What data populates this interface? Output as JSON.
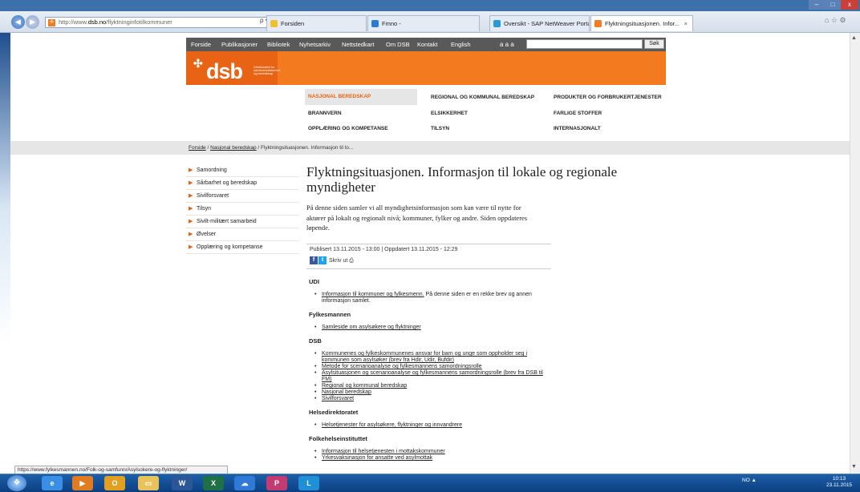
{
  "browser": {
    "window_controls": {
      "minimize": "–",
      "maximize": "□",
      "close": "x"
    },
    "back_icon": "back-arrow-icon",
    "forward_icon": "forward-arrow-icon",
    "address": {
      "prefix": "http://www.",
      "host": "dsb.no",
      "path": "/flyktninginfotilkommuner"
    },
    "address_tools": "ρ ▾ C",
    "tabs": [
      {
        "label": "Forsiden",
        "icon_color": "#f0c030"
      },
      {
        "label": "Fmno -",
        "icon_color": "#2a7bd6"
      },
      {
        "label": "Oversikt - SAP NetWeaver Portal",
        "icon_color": "#2a9ad6"
      },
      {
        "label": "Flyktningsituasjonen. Infor...",
        "icon_color": "#f47b20"
      }
    ],
    "tab_close": "×",
    "right_tools": "⌂ ☆ ⚙"
  },
  "site": {
    "topnav": [
      "Forside",
      "Publikasjoner",
      "Bibliotek",
      "Nyhetsarkiv",
      "Nettstedkart",
      "Om DSB",
      "Kontakt",
      "English"
    ],
    "font_size_links": "a a a",
    "search_button": "Søk",
    "logo_text": "dsb",
    "logo_mark": "✣",
    "logo_subtitle": "Direktoratet for samfunnssikkerhet og beredskap",
    "megamenu": [
      "NASJONAL BEREDSKAP",
      "REGIONAL OG KOMMUNAL BEREDSKAP",
      "PRODUKTER OG FORBRUKERTJENESTER",
      "BRANNVERN",
      "ELSIKKERHET",
      "FARLIGE STOFFER",
      "OPPLÆRING OG KOMPETANSE",
      "TILSYN",
      "INTERNASJONALT"
    ],
    "breadcrumb": {
      "home": "Forside",
      "sep": "/",
      "section": "Nasjonal beredskap",
      "current": "Flyktningsituasjonen. Informasjon til lo..."
    },
    "leftnav": [
      "Samordning",
      "Sårbarhet og beredskap",
      "Sivilforsvaret",
      "Tilsyn",
      "Sivilt-militært samarbeid",
      "Øvelser",
      "Opplæring og kompetanse"
    ],
    "accent_color": "#f47a20"
  },
  "article": {
    "title": "Flyktningsituasjonen. Informasjon til lokale og regionale myndigheter",
    "lead": "På denne siden samler vi all myndighetsinformasjon som kan være til nytte for aktører på lokalt og regionalt nivå; kommuner, fylker og andre. Siden oppdateres løpende.",
    "published": "Publisert 13.11.2015 - 13:00 | Oppdatert 13.11.2015 - 12:29",
    "print_label": "Skriv ut",
    "sections": [
      {
        "heading": "UDI",
        "items": [
          {
            "link": "Informasjon til kommuner og fylkesmenn.",
            "text": " På denne siden er en rekke brev og annen informasjon samlet."
          }
        ]
      },
      {
        "heading": "Fylkesmannen",
        "items": [
          {
            "link": "Samleside om asylsøkere og flyktninger",
            "text": ""
          }
        ]
      },
      {
        "heading": "DSB",
        "items": [
          {
            "link": "Kommunenes og fylkeskommunenes ansvar for barn og unge som oppholder seg i kommunen som asylsøker (brev fra Hdir, Udir, Bufdir)",
            "text": ""
          },
          {
            "link": "Metode for scenarioanalyse og fylkesmannens samordningsrolle",
            "text": ""
          },
          {
            "link": "Asylsituasjonen og scenarioanalyse og fylkesmannens samordningsrolle (brev fra DSB til FM)",
            "text": ""
          },
          {
            "link": "Regional og kommunal beredskap",
            "text": ""
          },
          {
            "link": "Nasjonal beredskap",
            "text": ""
          },
          {
            "link": "Sivilforsvaret",
            "text": ""
          }
        ]
      },
      {
        "heading": "Helsedirektoratet",
        "items": [
          {
            "link": "Helsetjenester for asylsøkere, flyktninger og innvandrere",
            "text": ""
          }
        ]
      },
      {
        "heading": "Folkehelseinstituttet",
        "items": [
          {
            "link": "Informasjon til helsetjenesten i mottakskommuner",
            "text": ""
          },
          {
            "link": "Yrkesvaksinasjon for ansatte ved asylmottak",
            "text": ""
          }
        ]
      }
    ]
  },
  "status_url": "https://www.fylkesmannen.no/Folk-og-samfunn/Asylsokere-og-flyktninger/",
  "taskbar": {
    "apps": [
      {
        "name": "ie",
        "glyph": "e",
        "color": "#3a8ee6"
      },
      {
        "name": "media",
        "glyph": "▶",
        "color": "#e07b20"
      },
      {
        "name": "outlook",
        "glyph": "O",
        "color": "#e2a023"
      },
      {
        "name": "explorer",
        "glyph": "▭",
        "color": "#e8c35a"
      },
      {
        "name": "word",
        "glyph": "W",
        "color": "#2b5797"
      },
      {
        "name": "excel",
        "glyph": "X",
        "color": "#1e7145"
      },
      {
        "name": "onedrive",
        "glyph": "☁",
        "color": "#2f7ad6"
      },
      {
        "name": "publisher",
        "glyph": "P",
        "color": "#c23b72"
      },
      {
        "name": "lync",
        "glyph": "L",
        "color": "#1f8fd6"
      }
    ],
    "tray": "NO ▲",
    "time": "10:13",
    "date": "23.11.2015"
  }
}
